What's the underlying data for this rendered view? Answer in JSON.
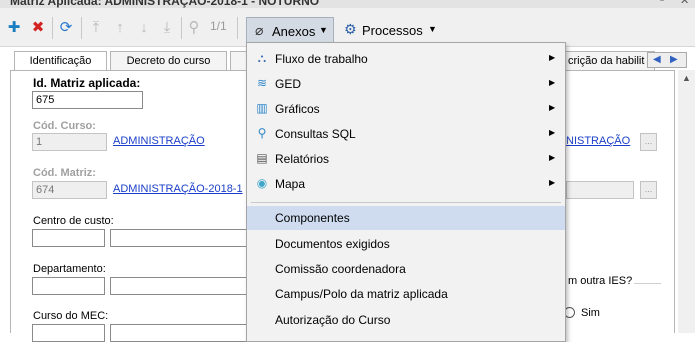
{
  "window": {
    "title": "Matriz Aplicada: ADMINISTRAÇÃO-2018-1 - NOTURNO"
  },
  "toolbar": {
    "page_indicator": "1/1",
    "anexos_label": "Anexos",
    "processos_label": "Processos",
    "icons": [
      "plus-icon",
      "delete-icon",
      "refresh-icon",
      "first-icon",
      "up-icon",
      "down-icon",
      "last-icon",
      "search-icon",
      "paperclip-icon",
      "gear-icon",
      "chevron-down-icon"
    ]
  },
  "tabs": [
    "Identificação",
    "Decreto do curso",
    "crição da habilit"
  ],
  "form": {
    "id_matriz_label": "Id. Matriz aplicada:",
    "id_matriz_value": "675",
    "cod_curso_label": "Cód. Curso:",
    "cod_curso_value": "1",
    "curso_link": "ADMINISTRAÇÃO",
    "curso_link_right": "NISTRAÇÃO",
    "cod_matriz_label": "Cód. Matriz:",
    "cod_matriz_value": "674",
    "matriz_link": "ADMINISTRAÇÃO-2018-1",
    "centro_custo_label": "Centro de custo:",
    "departamento_label": "Departamento:",
    "curso_mec_label": "Curso do MEC:",
    "outra_ies_label": "m outra IES?",
    "sim_label": "Sim",
    "lookup_btn": "..."
  },
  "menu": {
    "items": [
      {
        "label": "Fluxo de trabalho",
        "icon": "workflow-icon",
        "submenu": true
      },
      {
        "label": "GED",
        "icon": "ged-icon",
        "submenu": true
      },
      {
        "label": "Gráficos",
        "icon": "chart-icon",
        "submenu": true
      },
      {
        "label": "Consultas SQL",
        "icon": "search-icon",
        "submenu": true
      },
      {
        "label": "Relatórios",
        "icon": "report-icon",
        "submenu": true
      },
      {
        "label": "Mapa",
        "icon": "map-pin-icon",
        "submenu": true
      },
      {
        "label": "Componentes",
        "submenu": false,
        "highlighted": true
      },
      {
        "label": "Documentos exigidos",
        "submenu": false
      },
      {
        "label": "Comissão coordenadora",
        "submenu": false
      },
      {
        "label": "Campus/Polo da matriz aplicada",
        "submenu": false
      },
      {
        "label": "Autorização do Curso",
        "submenu": false
      }
    ]
  },
  "colors": {
    "accent": "#1b3fc8",
    "add": "#1a7fc1",
    "delete": "#d32222",
    "highlight": "#cfdcf0"
  }
}
